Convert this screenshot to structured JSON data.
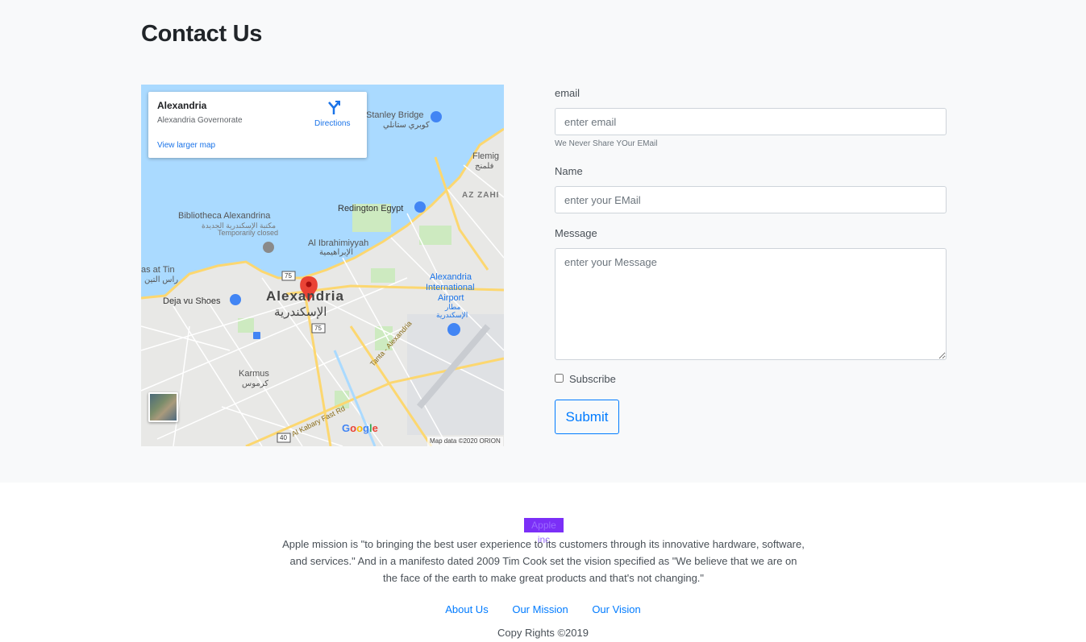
{
  "page": {
    "title": "Contact Us"
  },
  "map": {
    "card": {
      "place": "Alexandria",
      "region": "Alexandria Governorate",
      "larger_link": "View larger map",
      "directions": "Directions"
    },
    "labels": {
      "stanley_bridge": "Stanley Bridge",
      "stanley_bridge_ar": "كوبري ستانلي",
      "flemig": "Flemig",
      "flemig_ar": "فلمنج",
      "az_zahir": "AZ ZAHI",
      "redington": "Redington Egypt",
      "bibliotheca": "Bibliotheca Alexandrina",
      "bibliotheca_ar": "مكتبة الإسكندرية الجديدة",
      "bibliotheca_status": "Temporarily closed",
      "al_ibrahimiyyah": "Al Ibrahimiyyah",
      "al_ibrahimiyyah_ar": "الإبراهيمية",
      "ras_el_tin": "as at Tin",
      "ras_el_tin_ar": "راس التين",
      "city": "Alexandria",
      "city_ar": "الإسكندرية",
      "deja_vu": "Deja vu Shoes",
      "airport_1": "Alexandria",
      "airport_2": "International",
      "airport_3": "Airport",
      "airport_ar_1": "مطار",
      "airport_ar_2": "الإسكندرية",
      "karmus": "Karmus",
      "karmus_ar": "كرموس",
      "tanta_road": "Tanta - Alexandria",
      "kabary_road": "Al Kabary Fast Rd",
      "route_75": "75",
      "route_40": "40"
    },
    "google": "Google",
    "attribution": "Map data ©2020 ORION"
  },
  "form": {
    "email_label": "email",
    "email_placeholder": "enter email",
    "email_help": "We Never Share YOur EMail",
    "name_label": "Name",
    "name_placeholder": "enter your EMail",
    "message_label": "Message",
    "message_placeholder": "enter your Message",
    "subscribe_label": "Subscribe",
    "subscribe_checked": false,
    "submit_label": "Submit"
  },
  "footer": {
    "company": "Apple inc",
    "mission": "Apple mission is \"to bringing the best user experience to its customers through its innovative hardware, software, and services.\" And in a manifesto dated 2009 Tim Cook set the vision specified as \"We believe that we are on the face of the earth to make great products and that's not changing.\"",
    "links": [
      "About Us",
      "Our Mission",
      "Our Vision"
    ],
    "copyright": "Copy Rights ©2019"
  },
  "colors": {
    "accent": "#007bff",
    "section_bg": "#f8f9fa",
    "company_badge": "#7b2ff7",
    "water": "#aadaff",
    "pin": "#ea4335"
  }
}
